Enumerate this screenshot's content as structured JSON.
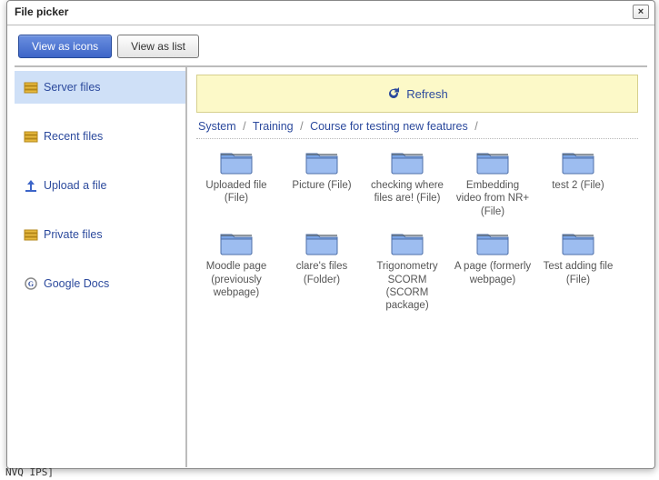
{
  "dialog": {
    "title": "File picker",
    "close": "×"
  },
  "viewbar": {
    "icons": "View as icons",
    "list": "View as list"
  },
  "sidebar": {
    "items": [
      {
        "label": "Server files",
        "icon": "server"
      },
      {
        "label": "Recent files",
        "icon": "server"
      },
      {
        "label": "Upload a file",
        "icon": "upload"
      },
      {
        "label": "Private files",
        "icon": "server"
      },
      {
        "label": "Google Docs",
        "icon": "google"
      }
    ]
  },
  "refresh": {
    "label": "Refresh"
  },
  "breadcrumb": {
    "parts": [
      "System",
      "Training",
      "Course for testing new features"
    ]
  },
  "files": [
    {
      "label": "Uploaded file (File)"
    },
    {
      "label": "Picture (File)"
    },
    {
      "label": "checking where files are! (File)"
    },
    {
      "label": "Embedding video from NR+ (File)"
    },
    {
      "label": "test 2 (File)"
    },
    {
      "label": "Moodle page (previously webpage)"
    },
    {
      "label": "clare's files (Folder)"
    },
    {
      "label": "Trigonometry SCORM (SCORM package)"
    },
    {
      "label": "A page (formerly webpage)"
    },
    {
      "label": "Test adding file (File)"
    }
  ],
  "page_bottom": "NVQ IPS]"
}
